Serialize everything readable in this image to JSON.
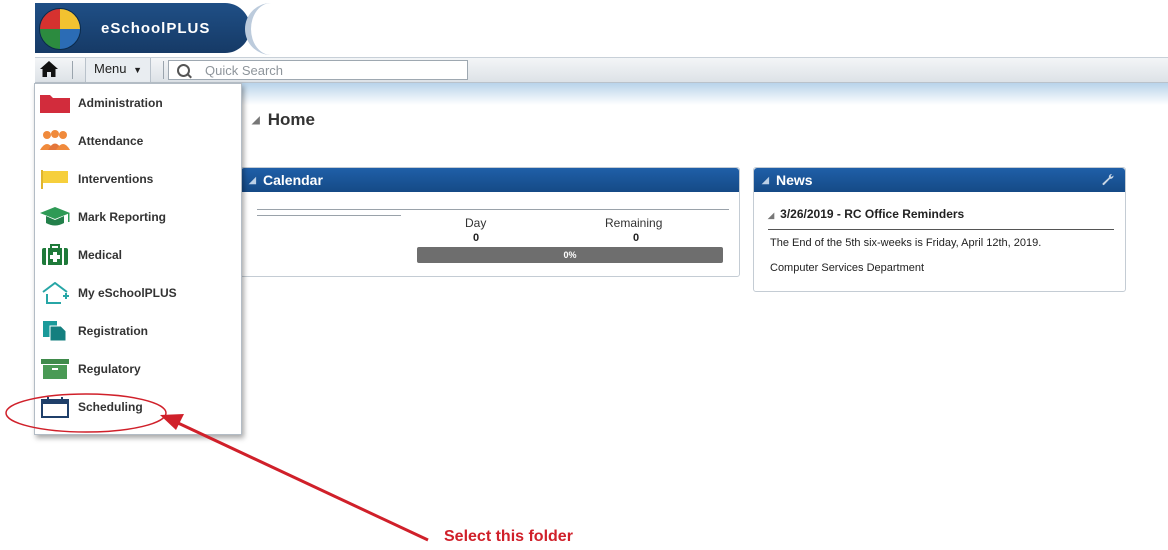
{
  "app": {
    "title": "eSchoolPLUS"
  },
  "toolbar": {
    "home_icon": "home-icon",
    "menu_label": "Menu",
    "search_placeholder": "Quick Search"
  },
  "menu": {
    "items": [
      {
        "label": "Administration",
        "icon": "folder-icon",
        "color": "#d22c3c"
      },
      {
        "label": "Attendance",
        "icon": "people-icon",
        "color": "#f08a3c"
      },
      {
        "label": "Interventions",
        "icon": "flag-icon",
        "color": "#f6cf3c"
      },
      {
        "label": "Mark Reporting",
        "icon": "graduation-cap-icon",
        "color": "#2e9a55"
      },
      {
        "label": "Medical",
        "icon": "medical-kit-icon",
        "color": "#1f7a3a"
      },
      {
        "label": "My eSchoolPLUS",
        "icon": "house-plus-icon",
        "color": "#27a6a6"
      },
      {
        "label": "Registration",
        "icon": "documents-icon",
        "color": "#1a9a9a"
      },
      {
        "label": "Regulatory",
        "icon": "archive-box-icon",
        "color": "#3f8a4a"
      },
      {
        "label": "Scheduling",
        "icon": "calendar-icon",
        "color": "#1f3f6a"
      }
    ]
  },
  "home": {
    "title": "Home"
  },
  "calendar": {
    "title": "Calendar",
    "day_label": "Day",
    "remaining_label": "Remaining",
    "day_value": "0",
    "remaining_value": "0",
    "progress_text": "0%",
    "progress_value": 0
  },
  "news": {
    "title": "News",
    "headline": "3/26/2019 - RC Office Reminders",
    "line1": "The End of the 5th six-weeks is Friday, April 12th, 2019.",
    "line2": "Computer Services Department"
  },
  "annotation": {
    "text": "Select this folder",
    "color": "#d0202a"
  }
}
